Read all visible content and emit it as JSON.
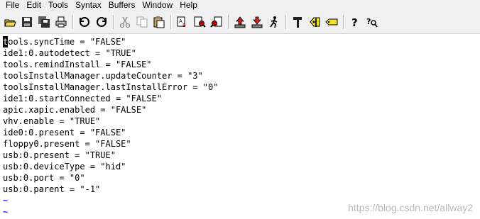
{
  "menu": [
    "File",
    "Edit",
    "Tools",
    "Syntax",
    "Buffers",
    "Window",
    "Help"
  ],
  "toolbar": {
    "icons": [
      "open-icon",
      "save-icon",
      "save-all-icon",
      "print-icon",
      "undo-icon",
      "redo-icon",
      "cut-icon",
      "copy-icon",
      "paste-icon",
      "replace-icon",
      "find-next-icon",
      "find-prev-icon",
      "load-session-icon",
      "save-session-icon",
      "run-script-icon",
      "make-icon",
      "build-tags-icon",
      "jump-tag-icon",
      "help-icon",
      "find-help-icon"
    ]
  },
  "editor": {
    "cursor_char": "t",
    "first_line_rest": "ools.syncTime = \"FALSE\"",
    "lines": [
      "ide1:0.autodetect = \"TRUE\"",
      "tools.remindInstall = \"FALSE\"",
      "toolsInstallManager.updateCounter = \"3\"",
      "toolsInstallManager.lastInstallError = \"0\"",
      "ide1:0.startConnected = \"FALSE\"",
      "apic.xapic.enabled = \"FALSE\"",
      "vhv.enable = \"TRUE\"",
      "ide0:0.present = \"FALSE\"",
      "floppy0.present = \"FALSE\"",
      "usb:0.present = \"TRUE\"",
      "usb:0.deviceType = \"hid\"",
      "usb:0.port = \"0\"",
      "usb:0.parent = \"-1\""
    ],
    "empty_line_marker": "~"
  },
  "watermark": "https://blog.csdn.net/allway2",
  "colors": {
    "tilde": "#2020ff",
    "chrome": "#f0f0f0",
    "text": "#000000"
  }
}
